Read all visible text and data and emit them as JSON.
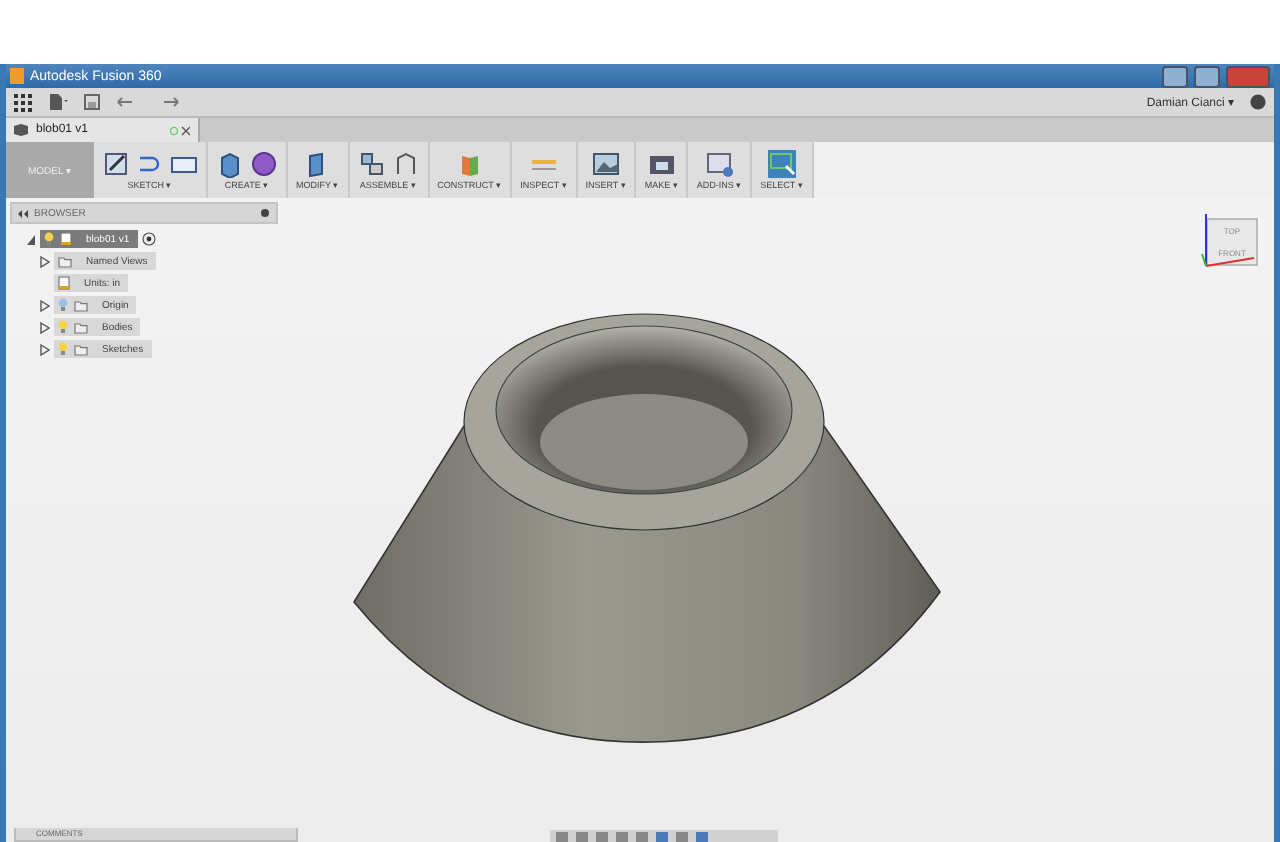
{
  "window": {
    "title": "Autodesk Fusion 360"
  },
  "user": {
    "name": "Damian Cianci ▾"
  },
  "document_tab": {
    "label": "blob01 v1"
  },
  "workspace": {
    "label": "MODEL ▾"
  },
  "toolbar": [
    {
      "label": "SKETCH ▾",
      "selected": false
    },
    {
      "label": "CREATE ▾",
      "selected": false
    },
    {
      "label": "MODIFY ▾",
      "selected": false
    },
    {
      "label": "ASSEMBLE ▾",
      "selected": false
    },
    {
      "label": "CONSTRUCT ▾",
      "selected": false
    },
    {
      "label": "INSPECT ▾",
      "selected": false
    },
    {
      "label": "INSERT ▾",
      "selected": false
    },
    {
      "label": "MAKE ▾",
      "selected": false
    },
    {
      "label": "ADD-INS ▾",
      "selected": false
    },
    {
      "label": "SELECT ▾",
      "selected": true
    }
  ],
  "browser": {
    "title": "BROWSER",
    "root": {
      "label": "blob01 v1",
      "expanded": true,
      "children": [
        {
          "label": "Named Views",
          "kind": "folder",
          "expandable": true
        },
        {
          "label": "Units: in",
          "kind": "units",
          "expandable": false
        },
        {
          "label": "Origin",
          "kind": "folder",
          "visible": false,
          "expandable": true
        },
        {
          "label": "Bodies",
          "kind": "folder",
          "visible": true,
          "expandable": true
        },
        {
          "label": "Sketches",
          "kind": "folder",
          "visible": true,
          "expandable": true
        }
      ]
    }
  },
  "viewcube": {
    "top": "TOP",
    "front": "FRONT"
  },
  "comments": {
    "title": "COMMENTS"
  }
}
